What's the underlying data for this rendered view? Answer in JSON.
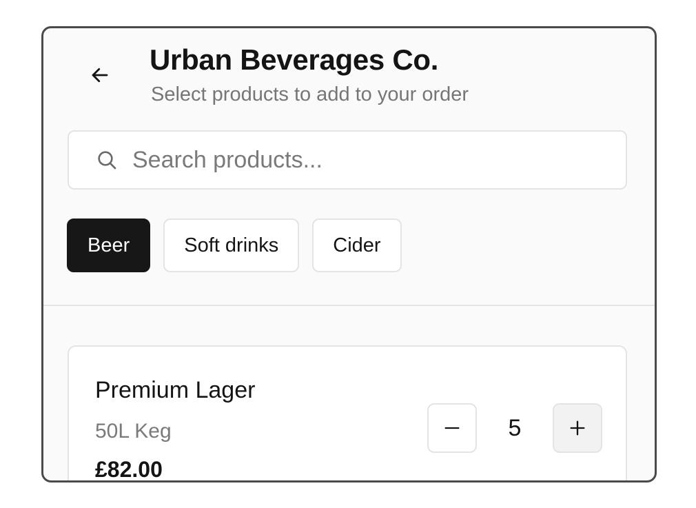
{
  "header": {
    "title": "Urban Beverages Co.",
    "subtitle": "Select products to add to your order",
    "back_icon": "arrow-left-icon"
  },
  "search": {
    "placeholder": "Search products...",
    "icon": "search-icon"
  },
  "categories": [
    {
      "label": "Beer",
      "active": true
    },
    {
      "label": "Soft drinks",
      "active": false
    },
    {
      "label": "Cider",
      "active": false
    }
  ],
  "products": [
    {
      "name": "Premium Lager",
      "size": "50L Keg",
      "price": "£82.00",
      "quantity": "5"
    }
  ],
  "colors": {
    "accent": "#171717",
    "border": "#e4e4e4",
    "muted_text": "#767676",
    "background": "#fafafa"
  }
}
